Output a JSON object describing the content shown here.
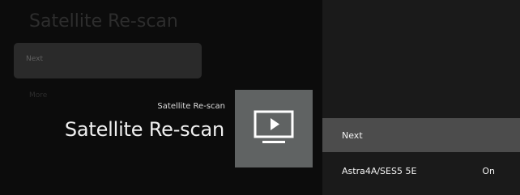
{
  "background": {
    "title": "Satellite Re-scan",
    "items": [
      {
        "label": "Next"
      },
      {
        "label": "More"
      }
    ]
  },
  "guidance": {
    "breadcrumb": "Satellite Re-scan",
    "title": "Satellite Re-scan",
    "icon": "tv-play-icon"
  },
  "actions": [
    {
      "label": "Next",
      "value": ""
    },
    {
      "label": "Astra4A/SES5 5E",
      "value": "On"
    }
  ],
  "colors": {
    "focused_action_bg": "#4c4c4c",
    "panel_bg": "#1a1a1a",
    "icon_tile_bg": "#606363"
  }
}
